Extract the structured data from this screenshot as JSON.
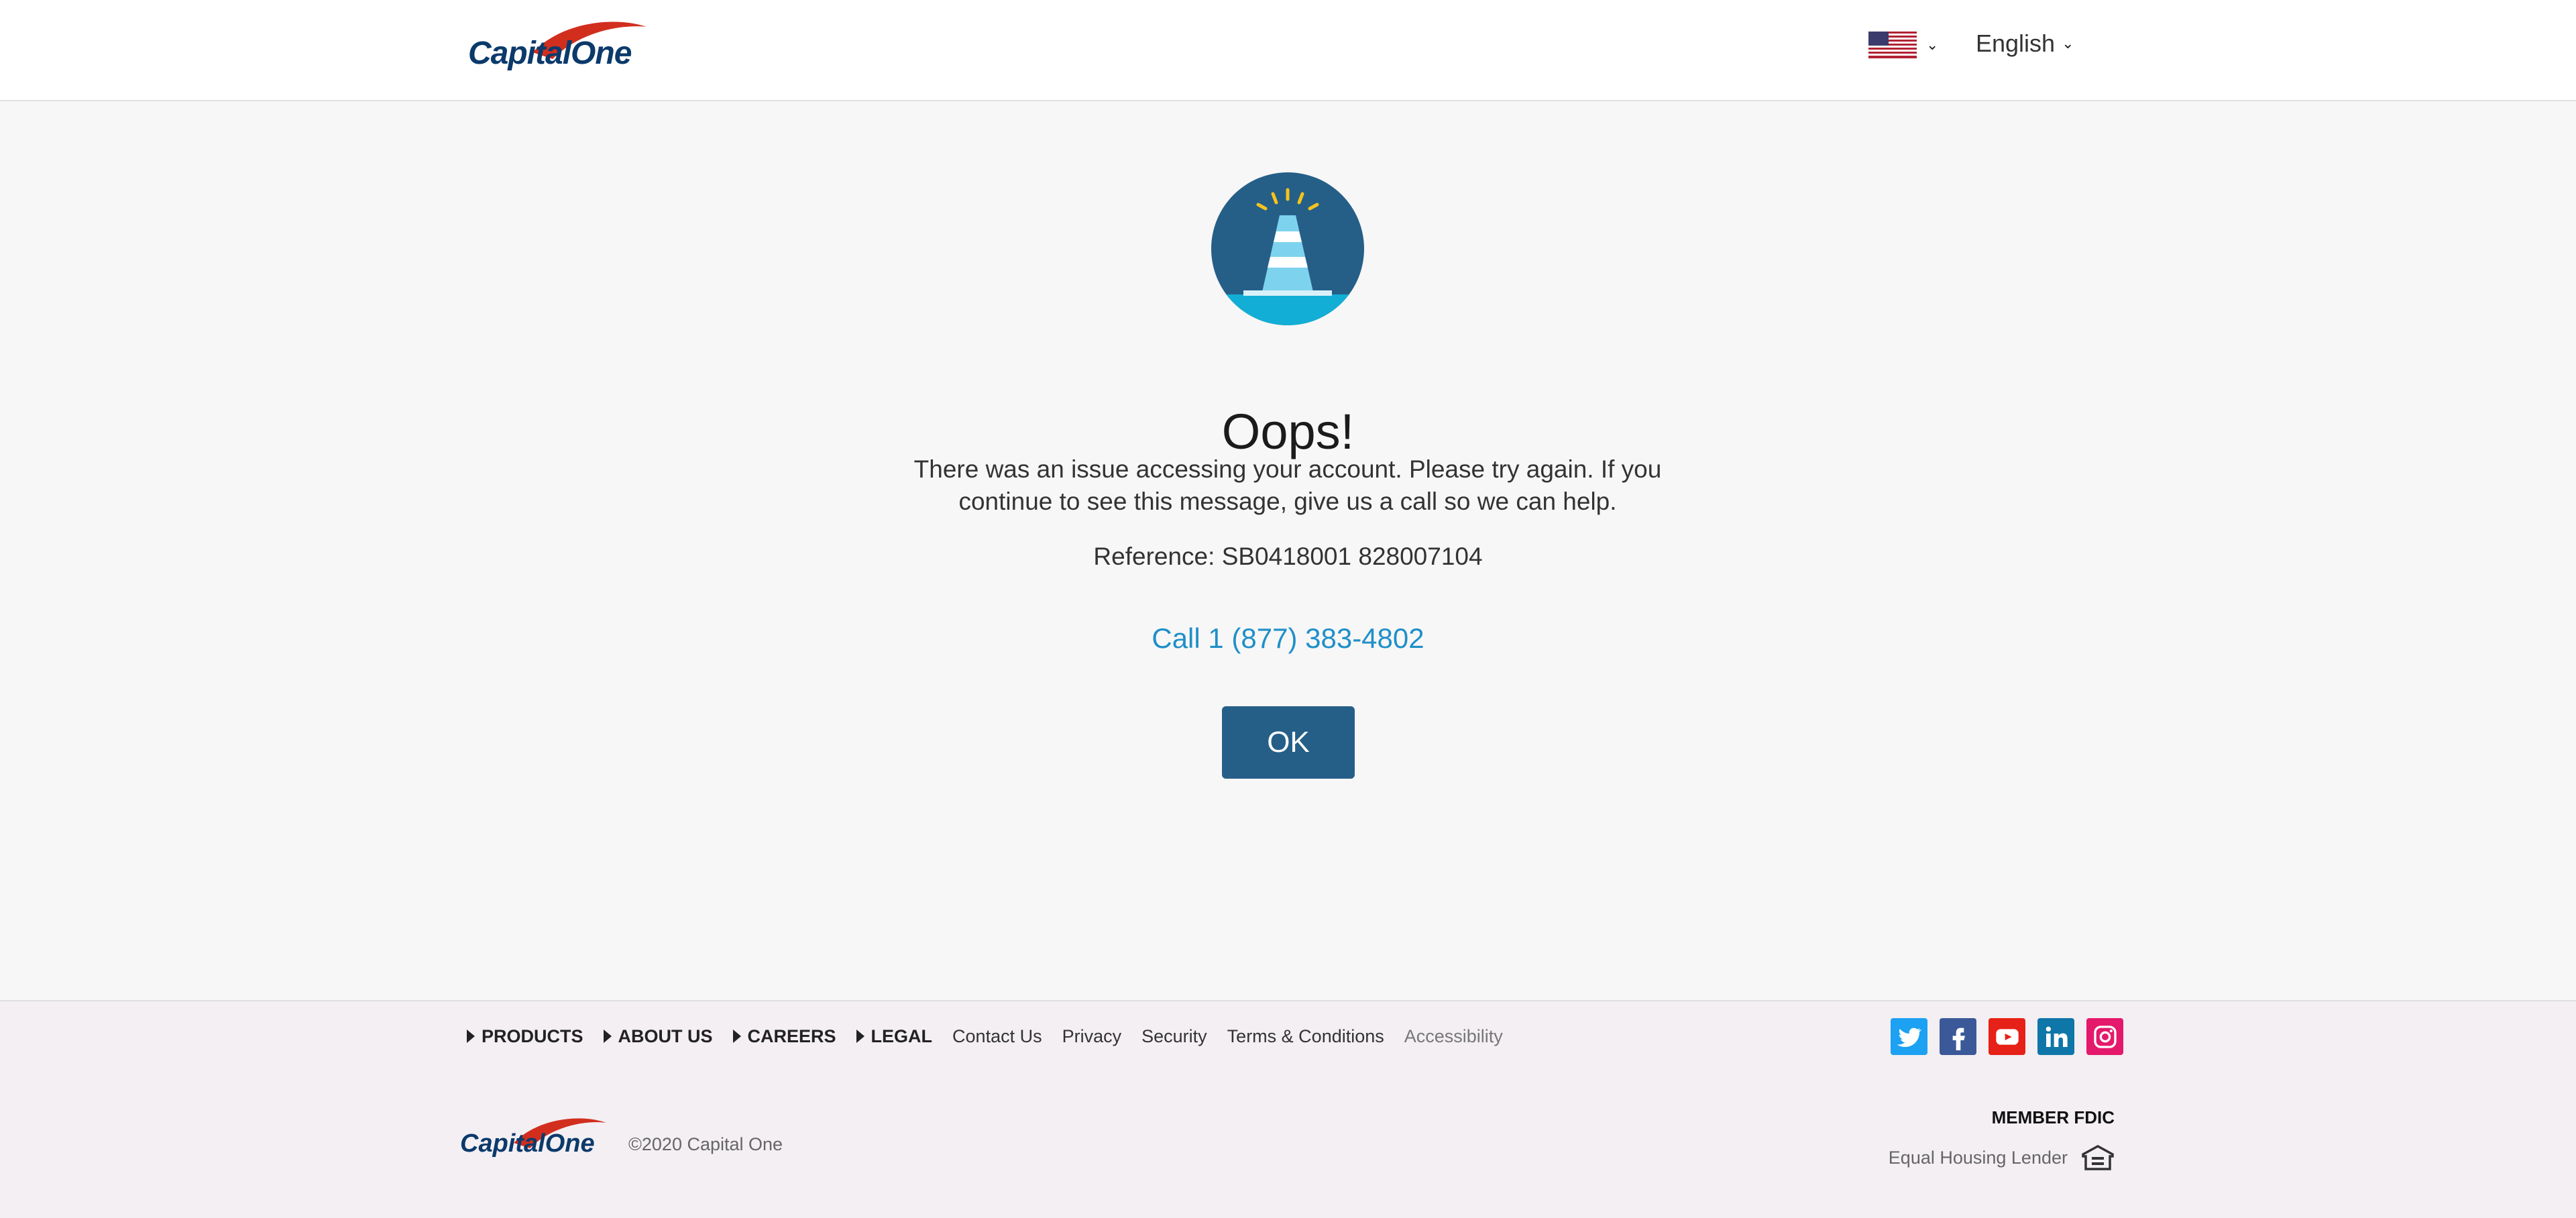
{
  "header": {
    "logo_text": "CapitalOne",
    "flag_icon": "us-flag-icon",
    "language": "English"
  },
  "main": {
    "title": "Oops!",
    "message": "There was an issue accessing your account. Please try again. If you continue to see this message, give us a call so we can help.",
    "reference": "Reference: SB0418001 828007104",
    "call_link": "Call 1 (877) 383-4802",
    "ok_label": "OK"
  },
  "footer": {
    "nav": [
      {
        "label": "PRODUCTS",
        "expandable": true
      },
      {
        "label": "ABOUT US",
        "expandable": true
      },
      {
        "label": "CAREERS",
        "expandable": true
      },
      {
        "label": "LEGAL",
        "expandable": true
      },
      {
        "label": "Contact Us",
        "expandable": false
      },
      {
        "label": "Privacy",
        "expandable": false
      },
      {
        "label": "Security",
        "expandable": false
      },
      {
        "label": "Terms & Conditions",
        "expandable": false
      },
      {
        "label": "Accessibility",
        "expandable": false
      }
    ],
    "social": [
      {
        "name": "twitter-icon",
        "color": "#1da1f2"
      },
      {
        "name": "facebook-icon",
        "color": "#3b5998"
      },
      {
        "name": "youtube-icon",
        "color": "#e62117"
      },
      {
        "name": "linkedin-icon",
        "color": "#0e76a8"
      },
      {
        "name": "instagram-icon",
        "color": "#e4196b"
      }
    ],
    "logo_text": "CapitalOne",
    "copyright": "©2020 Capital One",
    "member_fdic": "MEMBER FDIC",
    "equal_housing": "Equal Housing Lender"
  },
  "colors": {
    "brand_navy": "#0b3a6b",
    "brand_red": "#d22e1e",
    "button": "#255f88",
    "link": "#1f8fc9"
  }
}
